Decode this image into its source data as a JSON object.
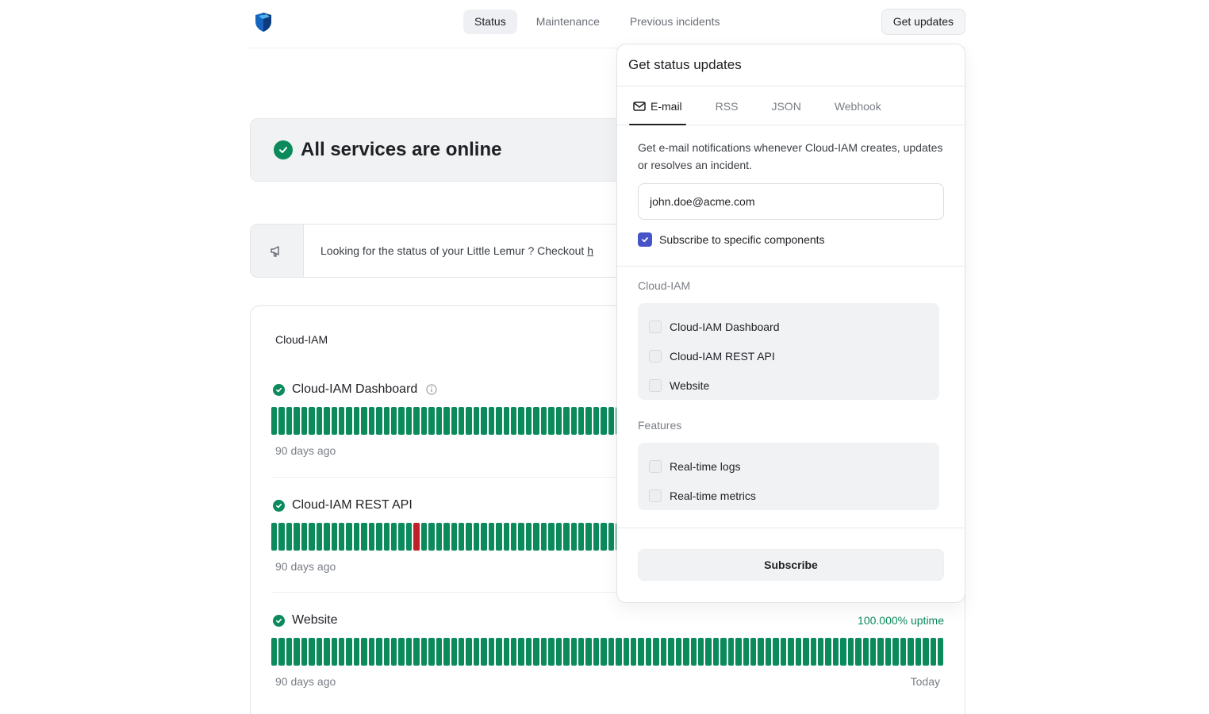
{
  "header": {
    "logo_icon": "shield-logo-icon",
    "nav": [
      {
        "label": "Status",
        "active": true
      },
      {
        "label": "Maintenance",
        "active": false
      },
      {
        "label": "Previous incidents",
        "active": false
      }
    ],
    "get_updates_label": "Get updates"
  },
  "status": {
    "title": "All services are online",
    "icon": "check-circle-icon",
    "color": "#0b8a5c"
  },
  "notice": {
    "icon": "megaphone-icon",
    "text": "Looking for the status of your Little Lemur ? Checkout",
    "link_text": "h"
  },
  "components": {
    "group_title": "Cloud-IAM",
    "services": [
      {
        "name": "Cloud-IAM Dashboard",
        "has_info": true,
        "uptime": "",
        "start_label": "90 days ago",
        "end_label": "",
        "down_days": []
      },
      {
        "name": "Cloud-IAM REST API",
        "has_info": false,
        "uptime": "",
        "start_label": "90 days ago",
        "end_label": "",
        "down_days": [
          19
        ]
      },
      {
        "name": "Website",
        "has_info": false,
        "uptime": "100.000% uptime",
        "start_label": "90 days ago",
        "end_label": "Today",
        "down_days": []
      }
    ],
    "days": 90,
    "colors": {
      "up": "#0b8a5c",
      "down": "#c02028"
    }
  },
  "popover": {
    "title": "Get status updates",
    "tabs": [
      {
        "label": "E-mail",
        "icon": "mail-icon",
        "active": true
      },
      {
        "label": "RSS",
        "active": false
      },
      {
        "label": "JSON",
        "active": false
      },
      {
        "label": "Webhook",
        "active": false
      }
    ],
    "description": "Get e-mail notifications whenever Cloud-IAM creates, updates or resolves an incident.",
    "email_value": "john.doe@acme.com",
    "subscribe_specific_label": "Subscribe to specific components",
    "subscribe_specific_checked": true,
    "groups": [
      {
        "label": "Cloud-IAM",
        "items": [
          "Cloud-IAM Dashboard",
          "Cloud-IAM REST API",
          "Website"
        ]
      },
      {
        "label": "Features",
        "items": [
          "Real-time logs",
          "Real-time metrics"
        ]
      }
    ],
    "subscribe_label": "Subscribe",
    "accent": "#4754c9"
  }
}
